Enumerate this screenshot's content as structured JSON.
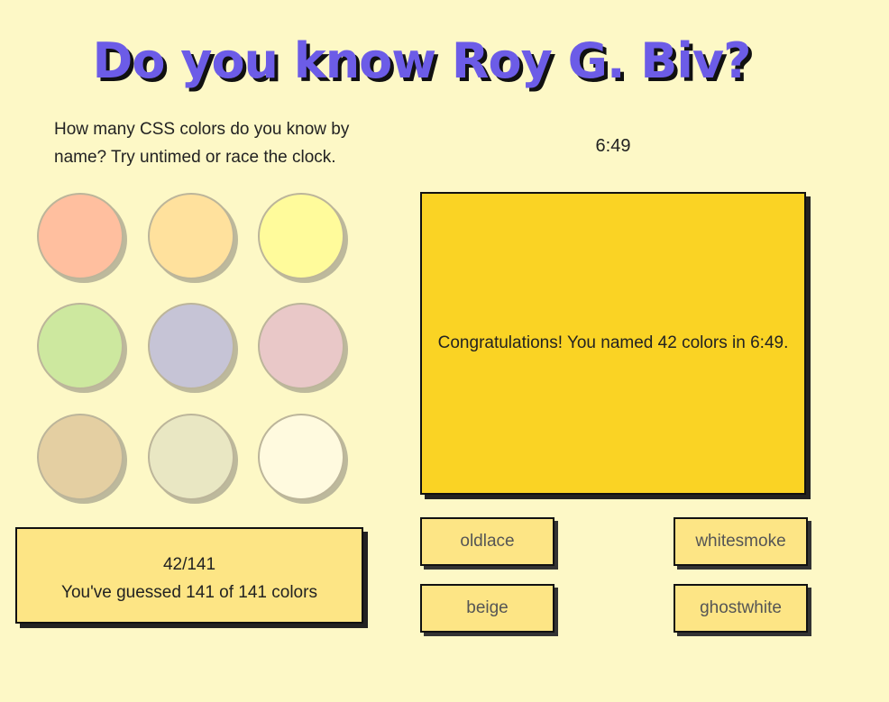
{
  "header": {
    "title": "Do you know Roy G. Biv?",
    "intro": "How many CSS colors do you know by name? Try untimed or race the clock."
  },
  "timer": {
    "display": "6:49"
  },
  "swatches": [
    {
      "color": "#ffbf9f"
    },
    {
      "color": "#ffe19d"
    },
    {
      "color": "#fffb9b"
    },
    {
      "color": "#cde89f"
    },
    {
      "color": "#c6c4d6"
    },
    {
      "color": "#e9c8c8"
    },
    {
      "color": "#e4cfa2"
    },
    {
      "color": "#e9e7c3"
    },
    {
      "color": "#fffadf"
    }
  ],
  "result_panel": {
    "message": "Congratulations! You named 42 colors in 6:49.",
    "background": "#fad324"
  },
  "score": {
    "fraction": "42/141",
    "summary": "You've guessed 141 of 141 colors"
  },
  "options": [
    {
      "label": "oldlace"
    },
    {
      "label": "whitesmoke"
    },
    {
      "label": "beige"
    },
    {
      "label": "ghostwhite"
    }
  ],
  "theme": {
    "page_background": "#fdf8c6",
    "title_color": "#6c5ce7",
    "button_background": "#fde585"
  }
}
